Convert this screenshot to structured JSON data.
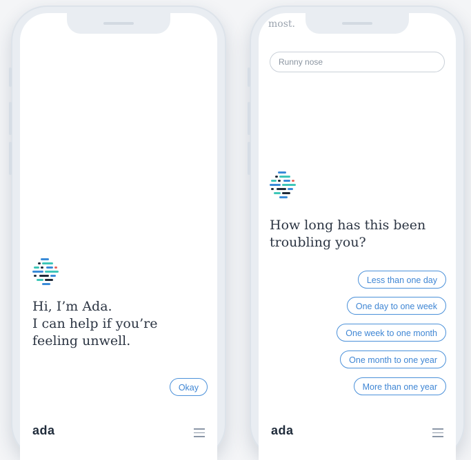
{
  "left_screen": {
    "greeting": "Hi, I’m Ada.\nI can help if you’re\nfeeling unwell.",
    "okay_label": "Okay",
    "footer_logo": "ada"
  },
  "right_screen": {
    "top_text": "most.",
    "input_value": "Runny nose",
    "question": "How long has this been\ntroubling you?",
    "options": [
      "Less than one day",
      "One day to one week",
      "One week to one month",
      "One month to one year",
      "More than one year"
    ],
    "footer_logo": "ada"
  },
  "icons": {
    "logo_mark": "ada-logo-icon",
    "menu": "hamburger-menu-icon"
  },
  "colors": {
    "accent": "#4a90d9",
    "text": "#2b3442",
    "logo_navy": "#1f2b3a",
    "logo_teal": "#3ec6b8",
    "logo_blue": "#3a8bd8",
    "logo_red": "#e9675c"
  }
}
